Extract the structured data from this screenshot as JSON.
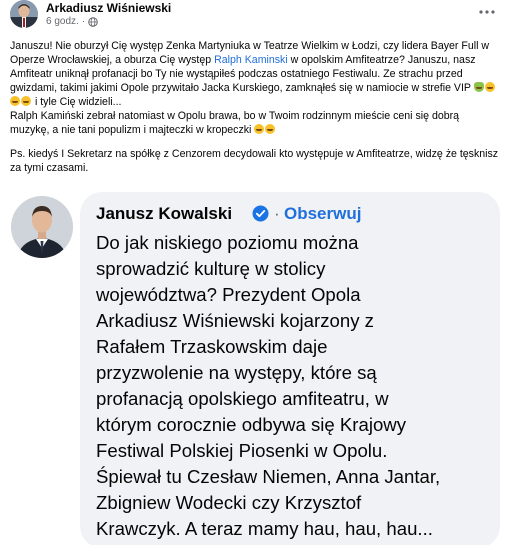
{
  "post": {
    "author": "Arkadiusz Wiśniewski",
    "time": "6 godz.",
    "privacy_icon": "globe-icon",
    "more_icon": "more-horizontal-icon",
    "paragraph1": {
      "text_a": "Januszu! Nie oburzył Cię występ Zenka Martyniuka w Teatrze Wielkim w Łodzi, czy lidera Bayer Full w Operze Wrocławskiej, a oburza Cię występ ",
      "tag": "Ralph Kaminski",
      "text_b": " w opolskim Amfiteatrze? Januszu, nasz Amfiteatr uniknął profanacji bo Ty nie wystąpiłeś podczas ostatniego Festiwalu. Ze strachu przed gwizdami, takimi jakimi Opole przywitało Jacka Kurskiego, zamknąłeś się w namiocie w strefie VIP ",
      "text_c": " i tyle Cię widzieli...",
      "text_d": "Ralph Kamiński zebrał natomiast w Opolu brawa, bo w Twoim rodzinnym mieście ceni się dobrą muzykę, a nie tani populizm i majteczki w kropeczki "
    },
    "paragraph2": "Ps. kiedyś I Sekretarz na spółkę z Cenzorem decydowali kto występuje w Amfiteatrze, widzę że tęsknisz za tymi czasami."
  },
  "embedded_comment": {
    "name": "Janusz Kowalski",
    "verified_icon": "verified-badge-icon",
    "separator": "·",
    "follow_label": "Obserwuj",
    "lines": [
      "Do jak niskiego poziomu można",
      "sprowadzić kulturę w stolicy",
      "województwa? Prezydent Opola",
      "Arkadiusz Wiśniewski kojarzony z",
      "Rafałem Trzaskowskim daje",
      "przyzwolenie na występy, które są",
      "profanacją opolskiego amfiteatru, w",
      "którym corocznie odbywa się Krajowy",
      "Festiwal Polskiej Piosenki w Opolu.",
      "Śpiewał tu Czesław Niemen, Anna Jantar,",
      "Zbigniew Wodecki czy Krzysztof",
      "Krawczyk. A teraz mamy hau, hau, hau..."
    ]
  },
  "colors": {
    "link": "#216fdb",
    "bubble_bg": "#f0f2f5",
    "meta_text": "#65676b",
    "verified": "#1b74e4"
  }
}
